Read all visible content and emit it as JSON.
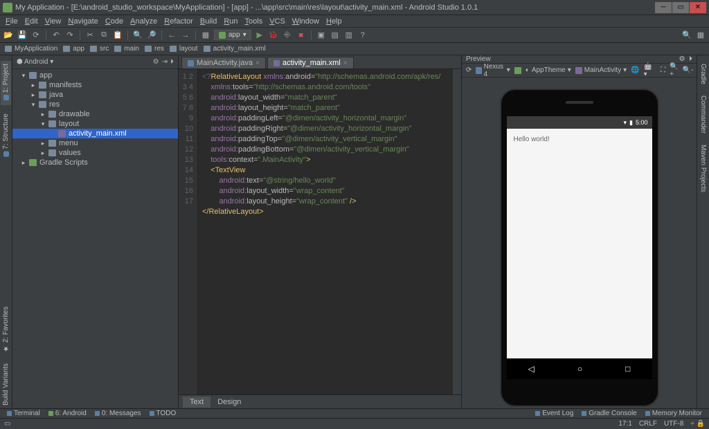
{
  "window": {
    "title": "My Application - [E:\\android_studio_workspace\\MyApplication] - [app] - ...\\app\\src\\main\\res\\layout\\activity_main.xml - Android Studio 1.0.1"
  },
  "menu": [
    "File",
    "Edit",
    "View",
    "Navigate",
    "Code",
    "Analyze",
    "Refactor",
    "Build",
    "Run",
    "Tools",
    "VCS",
    "Window",
    "Help"
  ],
  "breadcrumbs": [
    "MyApplication",
    "app",
    "src",
    "main",
    "res",
    "layout",
    "activity_main.xml"
  ],
  "runConfig": "app",
  "left_tabs": [
    "Project",
    "Structure"
  ],
  "right_tabs": [
    "Gradle",
    "Commander",
    "Maven Projects",
    "Favorites"
  ],
  "project": {
    "headerLabel": "Android",
    "tree": {
      "app": "app",
      "manifests": "manifests",
      "java": "java",
      "res": "res",
      "drawable": "drawable",
      "layout": "layout",
      "activity_main": "activity_main.xml",
      "menu": "menu",
      "values": "values",
      "gradle": "Gradle Scripts"
    }
  },
  "editor": {
    "tabs": [
      {
        "label": "MainActivity.java",
        "active": false
      },
      {
        "label": "activity_main.xml",
        "active": true
      }
    ],
    "lineCount": 17,
    "code": [
      {
        "segs": [
          {
            "c": "dim",
            "t": "<?"
          },
          {
            "c": "tag",
            "t": "RelativeLayout "
          },
          {
            "c": "ns",
            "t": "xmlns:"
          },
          {
            "c": "attr",
            "t": "android="
          },
          {
            "c": "val",
            "t": "\"http://schemas.android.com/apk/res/"
          }
        ]
      },
      {
        "segs": [
          {
            "c": "dim",
            "t": "    "
          },
          {
            "c": "ns",
            "t": "xmlns:"
          },
          {
            "c": "attr",
            "t": "tools="
          },
          {
            "c": "val",
            "t": "\"http://schemas.android.com/tools\""
          }
        ]
      },
      {
        "segs": [
          {
            "c": "dim",
            "t": "    "
          },
          {
            "c": "ns",
            "t": "android:"
          },
          {
            "c": "attr",
            "t": "layout_width="
          },
          {
            "c": "val",
            "t": "\"match_parent\""
          }
        ]
      },
      {
        "segs": [
          {
            "c": "dim",
            "t": "    "
          },
          {
            "c": "ns",
            "t": "android:"
          },
          {
            "c": "attr",
            "t": "layout_height="
          },
          {
            "c": "val",
            "t": "\"match_parent\""
          }
        ]
      },
      {
        "segs": [
          {
            "c": "dim",
            "t": "    "
          },
          {
            "c": "ns",
            "t": "android:"
          },
          {
            "c": "attr",
            "t": "paddingLeft="
          },
          {
            "c": "val",
            "t": "\"@dimen/activity_horizontal_margin\""
          }
        ]
      },
      {
        "segs": [
          {
            "c": "dim",
            "t": "    "
          },
          {
            "c": "ns",
            "t": "android:"
          },
          {
            "c": "attr",
            "t": "paddingRight="
          },
          {
            "c": "val",
            "t": "\"@dimen/activity_horizontal_margin\""
          }
        ]
      },
      {
        "segs": [
          {
            "c": "dim",
            "t": "    "
          },
          {
            "c": "ns",
            "t": "android:"
          },
          {
            "c": "attr",
            "t": "paddingTop="
          },
          {
            "c": "val",
            "t": "\"@dimen/activity_vertical_margin\""
          }
        ]
      },
      {
        "segs": [
          {
            "c": "dim",
            "t": "    "
          },
          {
            "c": "ns",
            "t": "android:"
          },
          {
            "c": "attr",
            "t": "paddingBottom="
          },
          {
            "c": "val",
            "t": "\"@dimen/activity_vertical_margin\""
          }
        ]
      },
      {
        "segs": [
          {
            "c": "dim",
            "t": "    "
          },
          {
            "c": "ns",
            "t": "tools:"
          },
          {
            "c": "attr",
            "t": "context="
          },
          {
            "c": "val",
            "t": "\".MainActivity\""
          },
          {
            "c": "tag",
            "t": ">"
          }
        ]
      },
      {
        "segs": [
          {
            "c": "dim",
            "t": ""
          }
        ]
      },
      {
        "segs": [
          {
            "c": "dim",
            "t": "    "
          },
          {
            "c": "tag",
            "t": "<TextView"
          }
        ]
      },
      {
        "segs": [
          {
            "c": "dim",
            "t": "        "
          },
          {
            "c": "ns",
            "t": "android:"
          },
          {
            "c": "attr",
            "t": "text="
          },
          {
            "c": "val",
            "t": "\"@string/hello_world\""
          }
        ]
      },
      {
        "segs": [
          {
            "c": "dim",
            "t": "        "
          },
          {
            "c": "ns",
            "t": "android:"
          },
          {
            "c": "attr",
            "t": "layout_width="
          },
          {
            "c": "val",
            "t": "\"wrap_content\""
          }
        ]
      },
      {
        "segs": [
          {
            "c": "dim",
            "t": "        "
          },
          {
            "c": "ns",
            "t": "android:"
          },
          {
            "c": "attr",
            "t": "layout_height="
          },
          {
            "c": "val",
            "t": "\"wrap_content\""
          },
          {
            "c": "tag",
            "t": " />"
          }
        ]
      },
      {
        "segs": [
          {
            "c": "dim",
            "t": ""
          }
        ]
      },
      {
        "segs": [
          {
            "c": "tag",
            "t": "</RelativeLayout>"
          }
        ]
      },
      {
        "segs": [
          {
            "c": "dim",
            "t": ""
          }
        ]
      }
    ],
    "bottomTabs": {
      "text": "Text",
      "design": "Design"
    }
  },
  "preview": {
    "title": "Preview",
    "device": "Nexus 4",
    "theme": "AppTheme",
    "activity": "MainActivity",
    "statusTime": "5:00",
    "appText": "Hello world!"
  },
  "toolwindows": {
    "terminal": "Terminal",
    "android": "6: Android",
    "messages": "0: Messages",
    "todo": "TODO",
    "eventlog": "Event Log",
    "gradleconsole": "Gradle Console",
    "memory": "Memory Monitor"
  },
  "status": {
    "pos": "17:1",
    "eol": "CRLF",
    "enc": "UTF-8"
  }
}
